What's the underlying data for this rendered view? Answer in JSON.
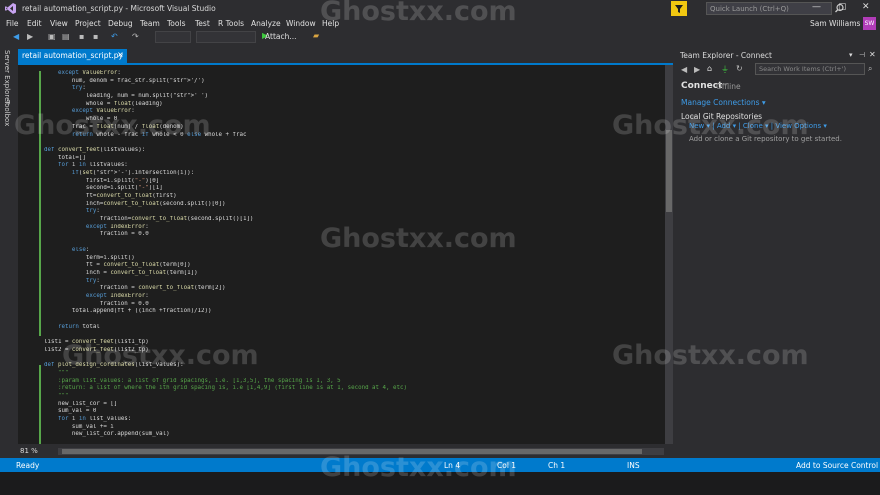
{
  "window": {
    "title": "retail automation_script.py - Microsoft Visual Studio",
    "quick_launch_placeholder": "Quick Launch (Ctrl+Q)",
    "user_name": "Sam Williams",
    "user_initials": "SW"
  },
  "menu": [
    "File",
    "Edit",
    "View",
    "Project",
    "Debug",
    "Team",
    "Tools",
    "Test",
    "R Tools",
    "Analyze",
    "Window",
    "Help"
  ],
  "toolbar": {
    "attach_label": "Attach..."
  },
  "side_tabs": {
    "server_explorer": "Server Explorer",
    "toolbox": "Toolbox"
  },
  "document_tab": {
    "label": "retail automation_script.py",
    "pin": "⊣",
    "close": "×"
  },
  "editor": {
    "zoom": "81 %",
    "lines": [
      "    except ValueError:",
      "        num, denom = frac_str.split('/')",
      "        try:",
      "            leading, num = num.split(' ')",
      "            whole = float(leading)",
      "        except ValueError:",
      "            whole = 0",
      "        frac = float(num) / float(denom)",
      "        return whole - frac if whole < 0 else whole + frac",
      "",
      "def convert_feet(listvalues):",
      "    total=[]",
      "    for i in listvalues:",
      "        if(set('-').intersection(i)):",
      "            first=i.split(\"-\")[0]",
      "            second=i.split(\"-\")[1]",
      "            ft=convert_to_float(first)",
      "            inch=convert_to_float(second.split()[0])",
      "            try:",
      "                fraction=convert_to_float(second.split()[1])",
      "            except IndexError:",
      "                fraction = 0.0",
      "",
      "        else:",
      "            term=i.split()",
      "            ft = convert_to_float(term[0])",
      "            inch = convert_to_float(term[1])",
      "            try:",
      "                fraction = convert_to_float(term[2])",
      "            except IndexError:",
      "                fraction = 0.0",
      "        total.append(ft + ((inch +fraction)/12))",
      "",
      "    return total",
      "",
      "list1 = convert_feet(list1_tp)",
      "list2 = convert_feet(list2_tp)",
      "",
      "def plot_design_cordinates(list_values):",
      "    \"\"\"",
      "    :param list_values: a list of grid spacings, i.e. [1,3,5], the spacing is 1, 3, 5",
      "    :return: a list of where the ith grid spacing is, i.e [1,4,9] (first line is at 1, second at 4, etc)",
      "    \"\"\"",
      "    new_list_cor = []",
      "    sum_val = 0",
      "    for i in list_values:",
      "        sum_val += i",
      "        new_list_cor.append(sum_val)"
    ]
  },
  "team_explorer": {
    "title": "Team Explorer - Connect",
    "search_placeholder": "Search Work Items (Ctrl+')",
    "connect": "Connect",
    "offline": "Offline",
    "manage_connections": "Manage Connections ▾",
    "local_git": "Local Git Repositories",
    "links": "New ▾  |  Add ▾  |  Clone ▾  |  View Options ▾",
    "hint": "Add or clone a Git repository to get started."
  },
  "status": {
    "ready": "Ready",
    "ln": "Ln 4",
    "col": "Col 1",
    "ch": "Ch 1",
    "ins": "INS",
    "source_control": "Add to Source Control ▴"
  },
  "watermark": "Ghostxx.com",
  "colors": {
    "accent": "#007acc",
    "background": "#2d2d30",
    "editor_bg": "#1e1e1e",
    "avatar": "#b13cb8"
  },
  "icons": [
    "visual-studio-logo-icon",
    "filter-icon",
    "search-icon",
    "minimize-icon",
    "maximize-icon",
    "close-icon",
    "back-icon",
    "forward-icon",
    "save-icon",
    "undo-icon",
    "redo-icon",
    "play-icon",
    "home-icon",
    "plug-icon",
    "refresh-icon"
  ]
}
